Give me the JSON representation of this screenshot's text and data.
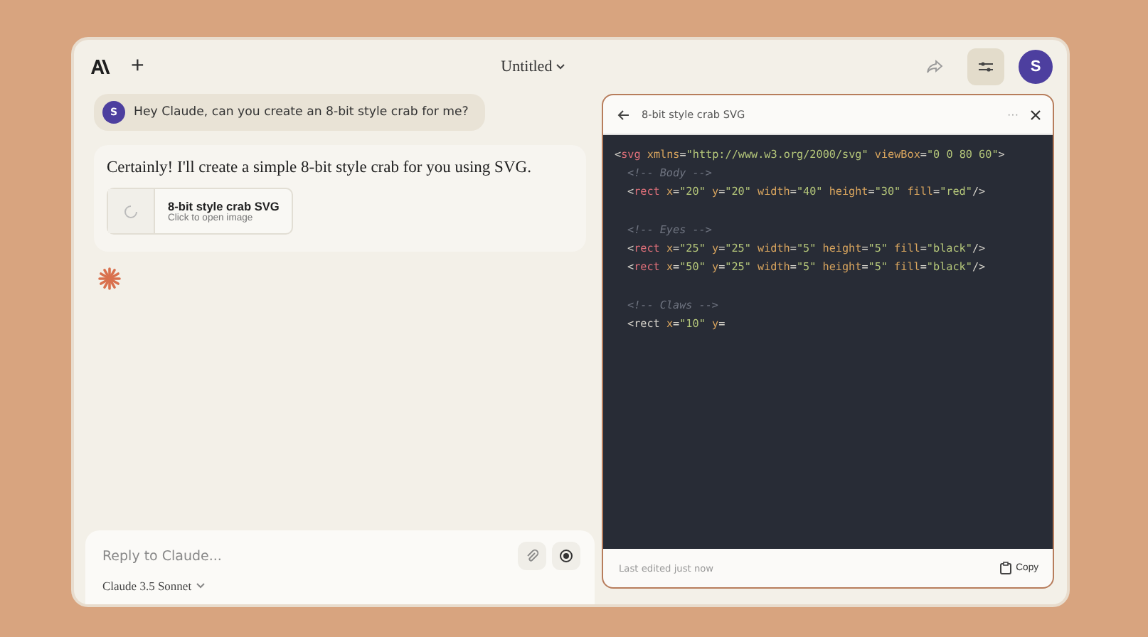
{
  "window": {
    "title": "Untitled"
  },
  "header": {
    "new_chat": "+"
  },
  "user_message": {
    "avatar": "S",
    "text": "Hey Claude, can you create an 8-bit style crab for me?"
  },
  "assistant_message": {
    "text": "Certainly! I'll create a simple 8-bit style crab for you using SVG.",
    "artifact_card": {
      "title": "8-bit style crab SVG",
      "subtitle": "Click to open image"
    }
  },
  "composer": {
    "placeholder": "Reply to Claude...",
    "model": "Claude 3.5 Sonnet"
  },
  "profile": {
    "avatar": "S"
  },
  "artifact": {
    "title": "8-bit style crab SVG",
    "menu": "···",
    "footer": "Last edited just now",
    "copy": "Copy",
    "code": [
      {
        "kind": "code",
        "tokens": [
          {
            "kind": "punct",
            "s": "<"
          },
          {
            "kind": "tag",
            "s": "svg"
          },
          {
            "kind": "attr",
            "s": " xmlns"
          },
          {
            "kind": "punct",
            "s": "="
          },
          {
            "kind": "str",
            "s": "\"http://www.w3.org/2000/svg\""
          },
          {
            "kind": "attr",
            "s": " viewBox"
          },
          {
            "kind": "punct",
            "s": "="
          },
          {
            "kind": "str",
            "s": "\"0 0 80 60\""
          },
          {
            "kind": "punct",
            "s": ">"
          }
        ],
        "children": [
          {
            "kind": "comment",
            "tokens": [
              {
                "kind": "comment",
                "s": "<!-- Body -->"
              }
            ]
          },
          {
            "kind": "code",
            "tokens": [
              {
                "kind": "punct",
                "s": "<"
              },
              {
                "kind": "tag",
                "s": "rect"
              },
              {
                "kind": "attr",
                "s": " x"
              },
              {
                "kind": "punct",
                "s": "="
              },
              {
                "kind": "str",
                "s": "\"20\""
              },
              {
                "kind": "attr",
                "s": " y"
              },
              {
                "kind": "punct",
                "s": "="
              },
              {
                "kind": "str",
                "s": "\"20\""
              },
              {
                "kind": "attr",
                "s": " width"
              },
              {
                "kind": "punct",
                "s": "="
              },
              {
                "kind": "str",
                "s": "\"40\""
              },
              {
                "kind": "attr",
                "s": " height"
              },
              {
                "kind": "punct",
                "s": "="
              },
              {
                "kind": "str",
                "s": "\"30\""
              },
              {
                "kind": "attr",
                "s": " fill"
              },
              {
                "kind": "punct",
                "s": "="
              },
              {
                "kind": "str",
                "s": "\"red\""
              },
              {
                "kind": "punct",
                "s": "/>"
              }
            ]
          },
          {
            "kind": "blank"
          },
          {
            "kind": "comment",
            "tokens": [
              {
                "kind": "comment",
                "s": "<!-- Eyes -->"
              }
            ]
          },
          {
            "kind": "code",
            "tokens": [
              {
                "kind": "punct",
                "s": "<"
              },
              {
                "kind": "tag",
                "s": "rect"
              },
              {
                "kind": "attr",
                "s": " x"
              },
              {
                "kind": "punct",
                "s": "="
              },
              {
                "kind": "str",
                "s": "\"25\""
              },
              {
                "kind": "attr",
                "s": " y"
              },
              {
                "kind": "punct",
                "s": "="
              },
              {
                "kind": "str",
                "s": "\"25\""
              },
              {
                "kind": "attr",
                "s": " width"
              },
              {
                "kind": "punct",
                "s": "="
              },
              {
                "kind": "str",
                "s": "\"5\""
              },
              {
                "kind": "attr",
                "s": " height"
              },
              {
                "kind": "punct",
                "s": "="
              },
              {
                "kind": "str",
                "s": "\"5\""
              },
              {
                "kind": "attr",
                "s": " fill"
              },
              {
                "kind": "punct",
                "s": "="
              },
              {
                "kind": "str",
                "s": "\"black\""
              },
              {
                "kind": "punct",
                "s": "/>"
              }
            ]
          },
          {
            "kind": "code",
            "tokens": [
              {
                "kind": "punct",
                "s": "<"
              },
              {
                "kind": "tag",
                "s": "rect"
              },
              {
                "kind": "attr",
                "s": " x"
              },
              {
                "kind": "punct",
                "s": "="
              },
              {
                "kind": "str",
                "s": "\"50\""
              },
              {
                "kind": "attr",
                "s": " y"
              },
              {
                "kind": "punct",
                "s": "="
              },
              {
                "kind": "str",
                "s": "\"25\""
              },
              {
                "kind": "attr",
                "s": " width"
              },
              {
                "kind": "punct",
                "s": "="
              },
              {
                "kind": "str",
                "s": "\"5\""
              },
              {
                "kind": "attr",
                "s": " height"
              },
              {
                "kind": "punct",
                "s": "="
              },
              {
                "kind": "str",
                "s": "\"5\""
              },
              {
                "kind": "attr",
                "s": " fill"
              },
              {
                "kind": "punct",
                "s": "="
              },
              {
                "kind": "str",
                "s": "\"black\""
              },
              {
                "kind": "punct",
                "s": "/>"
              }
            ]
          },
          {
            "kind": "blank"
          },
          {
            "kind": "comment",
            "tokens": [
              {
                "kind": "comment",
                "s": "<!-- Claws -->"
              }
            ]
          },
          {
            "kind": "code",
            "tokens": [
              {
                "kind": "punct",
                "s": "<"
              },
              {
                "kind": "punct",
                "s": "rect"
              },
              {
                "kind": "attr",
                "s": " x"
              },
              {
                "kind": "punct",
                "s": "="
              },
              {
                "kind": "str",
                "s": "\"10\""
              },
              {
                "kind": "attr",
                "s": " y"
              },
              {
                "kind": "punct",
                "s": "="
              }
            ]
          }
        ]
      }
    ]
  }
}
